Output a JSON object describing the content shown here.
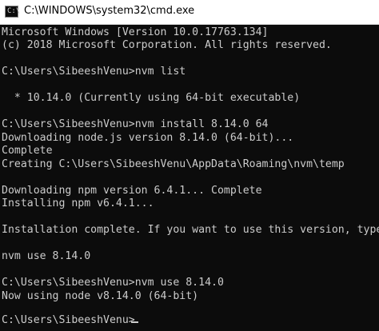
{
  "window": {
    "title": "C:\\WINDOWS\\system32\\cmd.exe",
    "icon": "cmd-icon",
    "icon_glyph": "C:\\"
  },
  "console": {
    "lines": [
      "Microsoft Windows [Version 10.0.17763.134]",
      "(c) 2018 Microsoft Corporation. All rights reserved.",
      "",
      "C:\\Users\\SibeeshVenu>nvm list",
      "",
      "  * 10.14.0 (Currently using 64-bit executable)",
      "",
      "C:\\Users\\SibeeshVenu>nvm install 8.14.0 64",
      "Downloading node.js version 8.14.0 (64-bit)...",
      "Complete",
      "Creating C:\\Users\\SibeeshVenu\\AppData\\Roaming\\nvm\\temp",
      "",
      "Downloading npm version 6.4.1... Complete",
      "Installing npm v6.4.1...",
      "",
      "Installation complete. If you want to use this version, type",
      "",
      "nvm use 8.14.0",
      "",
      "C:\\Users\\SibeeshVenu>nvm use 8.14.0",
      "Now using node v8.14.0 (64-bit)",
      "",
      "C:\\Users\\SibeeshVenu>"
    ]
  },
  "colors": {
    "console_background": "#0c0c0c",
    "console_text": "#cccccc",
    "titlebar_background": "#ffffff"
  }
}
